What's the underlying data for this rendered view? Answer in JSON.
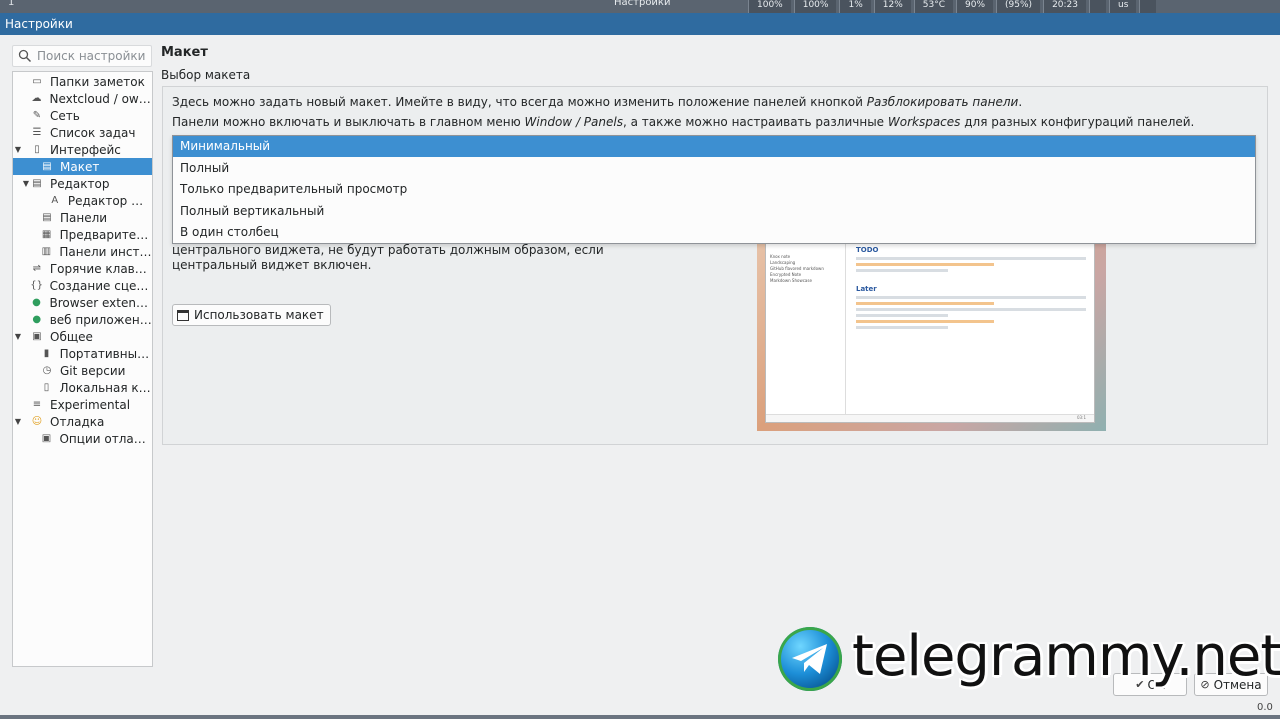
{
  "system_panel": {
    "workspace_number": "1",
    "window_title": "Настройки",
    "tray": [
      "100%",
      "100%",
      "1%",
      "12%",
      "53°C",
      "90%",
      "(95%)",
      "20:23",
      "",
      "us",
      ""
    ]
  },
  "window": {
    "title": "Настройки"
  },
  "sidebar": {
    "search_placeholder": "Поиск настройки",
    "items": [
      {
        "label": "Папки заметок",
        "icon": "folder-icon"
      },
      {
        "label": "Nextcloud / own...",
        "icon": "cloud-icon"
      },
      {
        "label": "Сеть",
        "icon": "network-icon"
      },
      {
        "label": "Список задач",
        "icon": "task-list-icon"
      },
      {
        "label": "Интерфейс",
        "icon": "interface-icon",
        "expanded": true
      },
      {
        "label": "Макет",
        "icon": "layout-icon",
        "selected": true
      },
      {
        "label": "Редактор",
        "icon": "editor-icon",
        "expanded": true
      },
      {
        "label": "Редактор ш...",
        "icon": "font-icon"
      },
      {
        "label": "Панели",
        "icon": "panels-icon"
      },
      {
        "label": "Предварител...",
        "icon": "preview-icon"
      },
      {
        "label": "Панели инстр...",
        "icon": "toolbar-icon"
      },
      {
        "label": "Горячие клави...",
        "icon": "shortcuts-icon"
      },
      {
        "label": "Создание сцен...",
        "icon": "script-icon"
      },
      {
        "label": "Browser extensi...",
        "icon": "globe-icon"
      },
      {
        "label": "веб приложение",
        "icon": "globe-icon"
      },
      {
        "label": "Общее",
        "icon": "general-icon",
        "expanded": true
      },
      {
        "label": "Портативный...",
        "icon": "portable-icon"
      },
      {
        "label": "Git версии",
        "icon": "clock-icon"
      },
      {
        "label": "Локальная ко...",
        "icon": "trash-icon"
      },
      {
        "label": "Experimental",
        "icon": "experimental-icon"
      },
      {
        "label": "Отладка",
        "icon": "debug-icon",
        "expanded": true
      },
      {
        "label": "Опции отладки",
        "icon": "debug-options-icon"
      }
    ]
  },
  "main": {
    "title": "Макет",
    "group_title": "Выбор макета",
    "desc1_pre": "Здесь можно задать новый макет. Имейте в виду, что всегда можно изменить положение панелей кнопкой ",
    "desc1_em": "Разблокировать панели",
    "desc1_post": ".",
    "desc2_pre": "Панели можно включать и выключать в главном меню ",
    "desc2_em1": "Window / Panels",
    "desc2_mid": ", а также можно настраивать различные ",
    "desc2_em2": "Workspaces",
    "desc2_post": " для разных конфигураций панелей.",
    "hidden_line1": "центрального виджета, не будут работать должным образом, если",
    "hidden_line2": "центральный виджет включен.",
    "use_button": "Использовать макет",
    "dropdown_options": [
      "Минимальный",
      "Полный",
      "Только предварительный просмотр",
      "Полный вертикальный",
      "В один столбец"
    ],
    "selected_option": "Минимальный",
    "preview": {
      "heading1": "TODO",
      "heading2": "Later",
      "sidebar_entries": [
        "Knox note",
        "Landscaping",
        "GitHub flavored markdown",
        "Encrypted Note",
        "Markdown Showcase"
      ],
      "status": "03:1"
    }
  },
  "buttons": {
    "ok": "OK",
    "cancel": "Отмена"
  },
  "corner_text": "0.0",
  "watermark": {
    "text": "telegrammy.net"
  },
  "colors": {
    "accent": "#3d8fd1",
    "titlebar": "#2f6ba0",
    "background": "#eff0f1"
  }
}
